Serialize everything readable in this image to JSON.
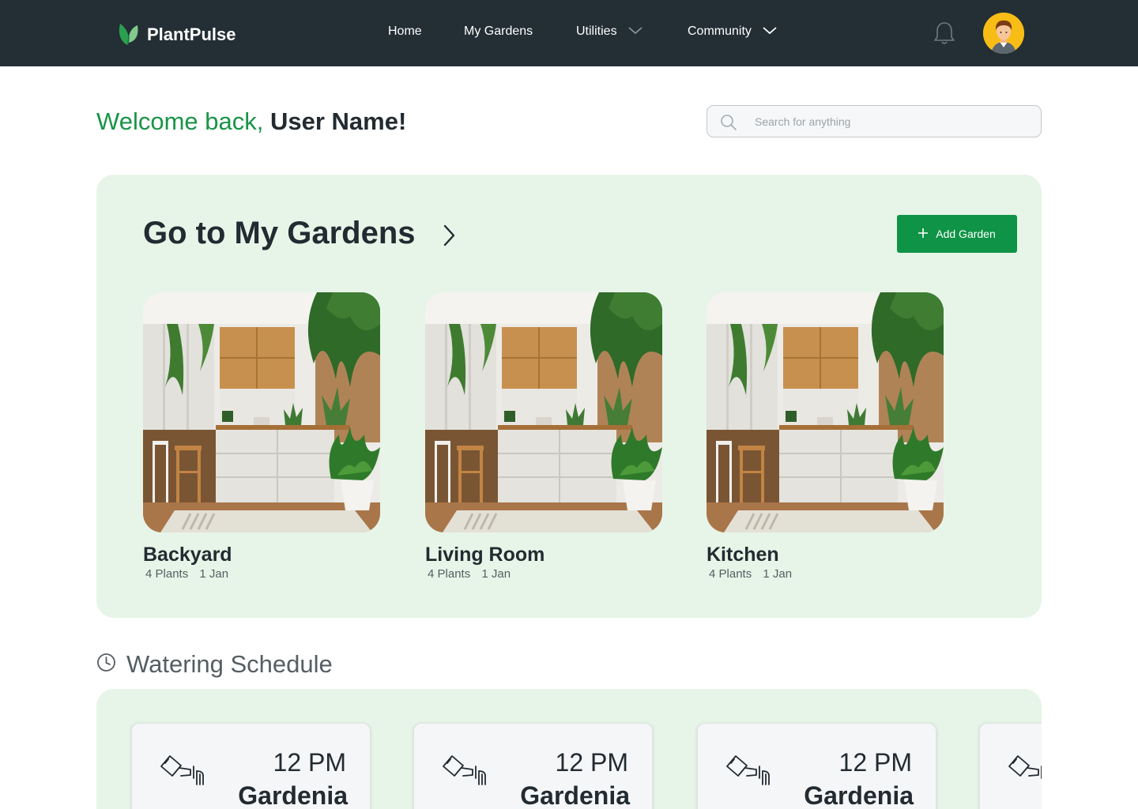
{
  "brand": {
    "name": "PlantPulse",
    "accent": "#1a9447",
    "navbar_color": "#232e35"
  },
  "nav": {
    "home": "Home",
    "my_gardens": "My Gardens",
    "utilities": "Utilities",
    "community": "Community"
  },
  "welcome": {
    "prefix": "Welcome back,",
    "name": "User Name!"
  },
  "search": {
    "placeholder": "Search for anything",
    "value": ""
  },
  "gardens": {
    "title": "Go to My Gardens",
    "add_label": "Add Garden",
    "items": [
      {
        "name": "Backyard",
        "plants": "4 Plants",
        "date": "1 Jan"
      },
      {
        "name": "Living Room",
        "plants": "4 Plants",
        "date": "1 Jan"
      },
      {
        "name": "Kitchen",
        "plants": "4 Plants",
        "date": "1 Jan"
      }
    ]
  },
  "schedule": {
    "title": "Watering Schedule",
    "items": [
      {
        "time": "12 PM",
        "plant": "Gardenia"
      },
      {
        "time": "12 PM",
        "plant": "Gardenia"
      },
      {
        "time": "12 PM",
        "plant": "Gardenia"
      },
      {
        "time": "",
        "plant": ""
      }
    ]
  },
  "icons": {
    "logo": "leaf-icon",
    "dropdown": "chevron-down-icon",
    "notifications": "bell-icon",
    "profile": "avatar",
    "search": "search-icon",
    "go": "chevron-right-icon",
    "add": "plus-icon",
    "schedule": "clock-icon",
    "watering": "watering-can-icon"
  },
  "colors": {
    "panel_bg": "#e7f5e8",
    "button_green": "#0f9346",
    "avatar_bg": "#f7bd16"
  }
}
